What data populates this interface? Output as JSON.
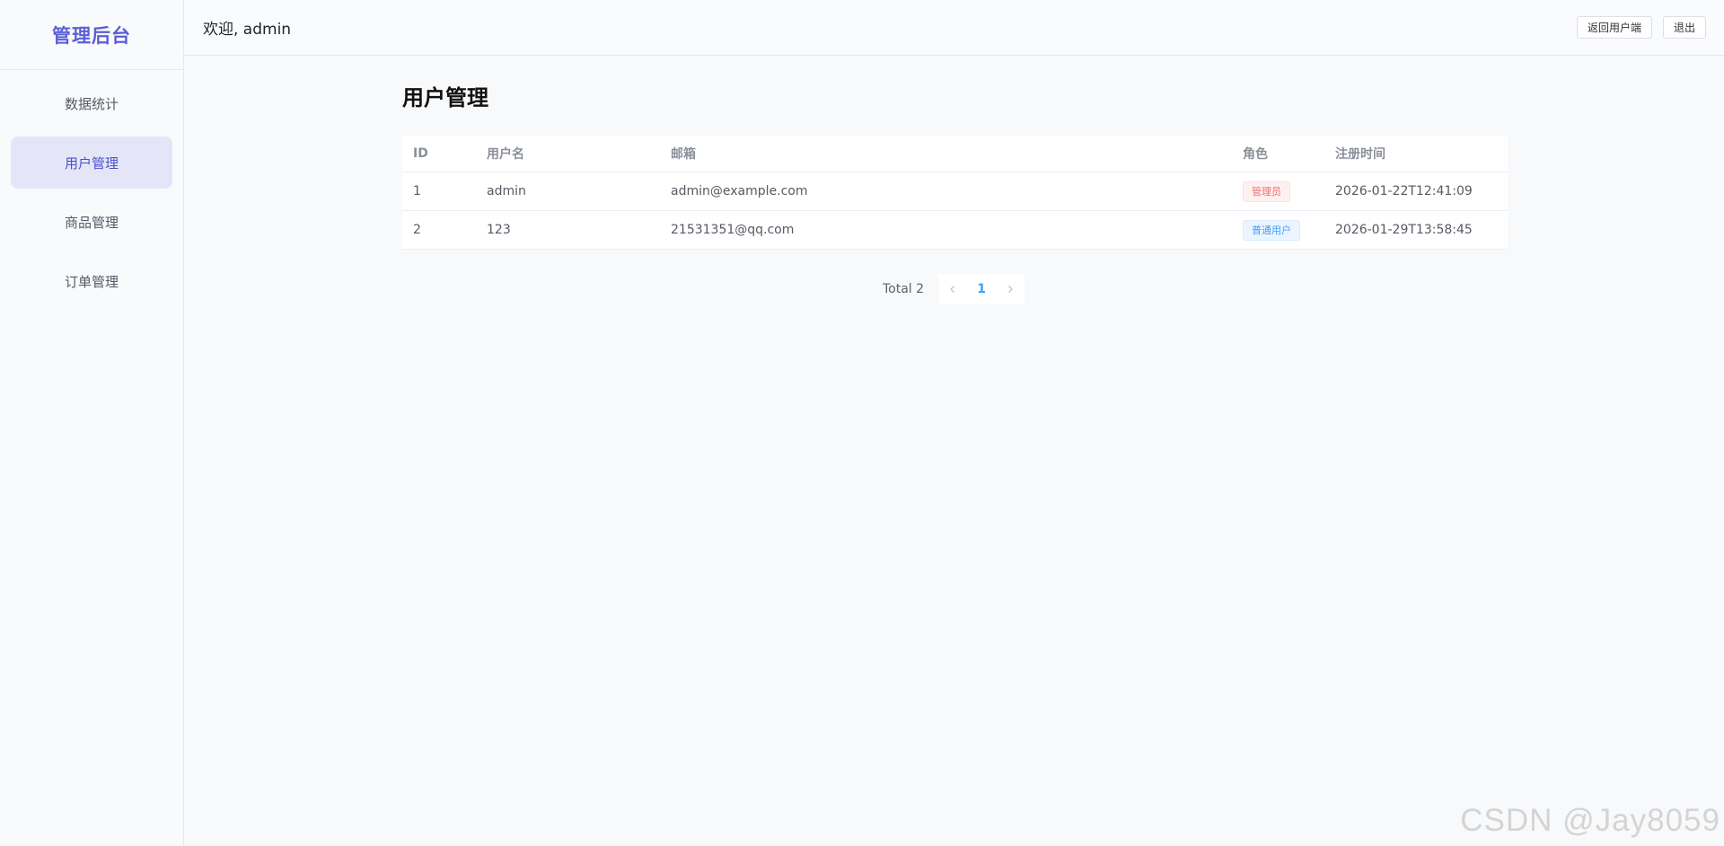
{
  "brand": "管理后台",
  "sidebar": {
    "items": [
      {
        "label": "数据统计",
        "active": false
      },
      {
        "label": "用户管理",
        "active": true
      },
      {
        "label": "商品管理",
        "active": false
      },
      {
        "label": "订单管理",
        "active": false
      }
    ]
  },
  "header": {
    "welcome": "欢迎, admin",
    "back_label": "返回用户端",
    "logout_label": "退出"
  },
  "main": {
    "title": "用户管理",
    "table": {
      "columns": [
        "ID",
        "用户名",
        "邮箱",
        "角色",
        "注册时间"
      ],
      "rows": [
        {
          "id": "1",
          "username": "admin",
          "email": "admin@example.com",
          "role": "管理员",
          "role_type": "admin",
          "created": "2026-01-22T12:41:09"
        },
        {
          "id": "2",
          "username": "123",
          "email": "21531351@qq.com",
          "role": "普通用户",
          "role_type": "user",
          "created": "2026-01-29T13:58:45"
        }
      ]
    },
    "pagination": {
      "total_label": "Total 2",
      "current_page": "1",
      "prev_icon": "chevron-left-icon",
      "next_icon": "chevron-right-icon"
    }
  },
  "watermark": "CSDN @Jay8059",
  "colors": {
    "accent": "#5b5fd6",
    "active_bg": "#e4e6f8",
    "admin_tag": "#f56c6c",
    "user_tag": "#409eff"
  }
}
